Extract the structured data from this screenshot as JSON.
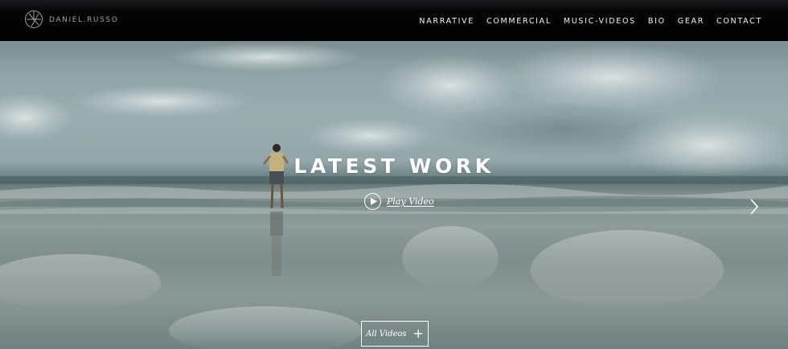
{
  "header": {
    "brand": "DANIEL.RUSSO",
    "logo_icon": "compass-monogram-icon",
    "nav": [
      "NARRATIVE",
      "COMMERCIAL",
      "MUSIC-VIDEOS",
      "BIO",
      "GEAR",
      "CONTACT"
    ]
  },
  "hero": {
    "title": "LATEST WORK",
    "play_label": "Play Video",
    "play_icon": "play-circle-icon",
    "next_icon": "chevron-right-icon",
    "all_videos_label": "All Videos",
    "all_videos_icon": "plus-icon"
  },
  "colors": {
    "header_bg": "#000000",
    "brand_text": "#a6a09a",
    "nav_text": "#f2f2f2",
    "hero_text": "#ffffff"
  }
}
